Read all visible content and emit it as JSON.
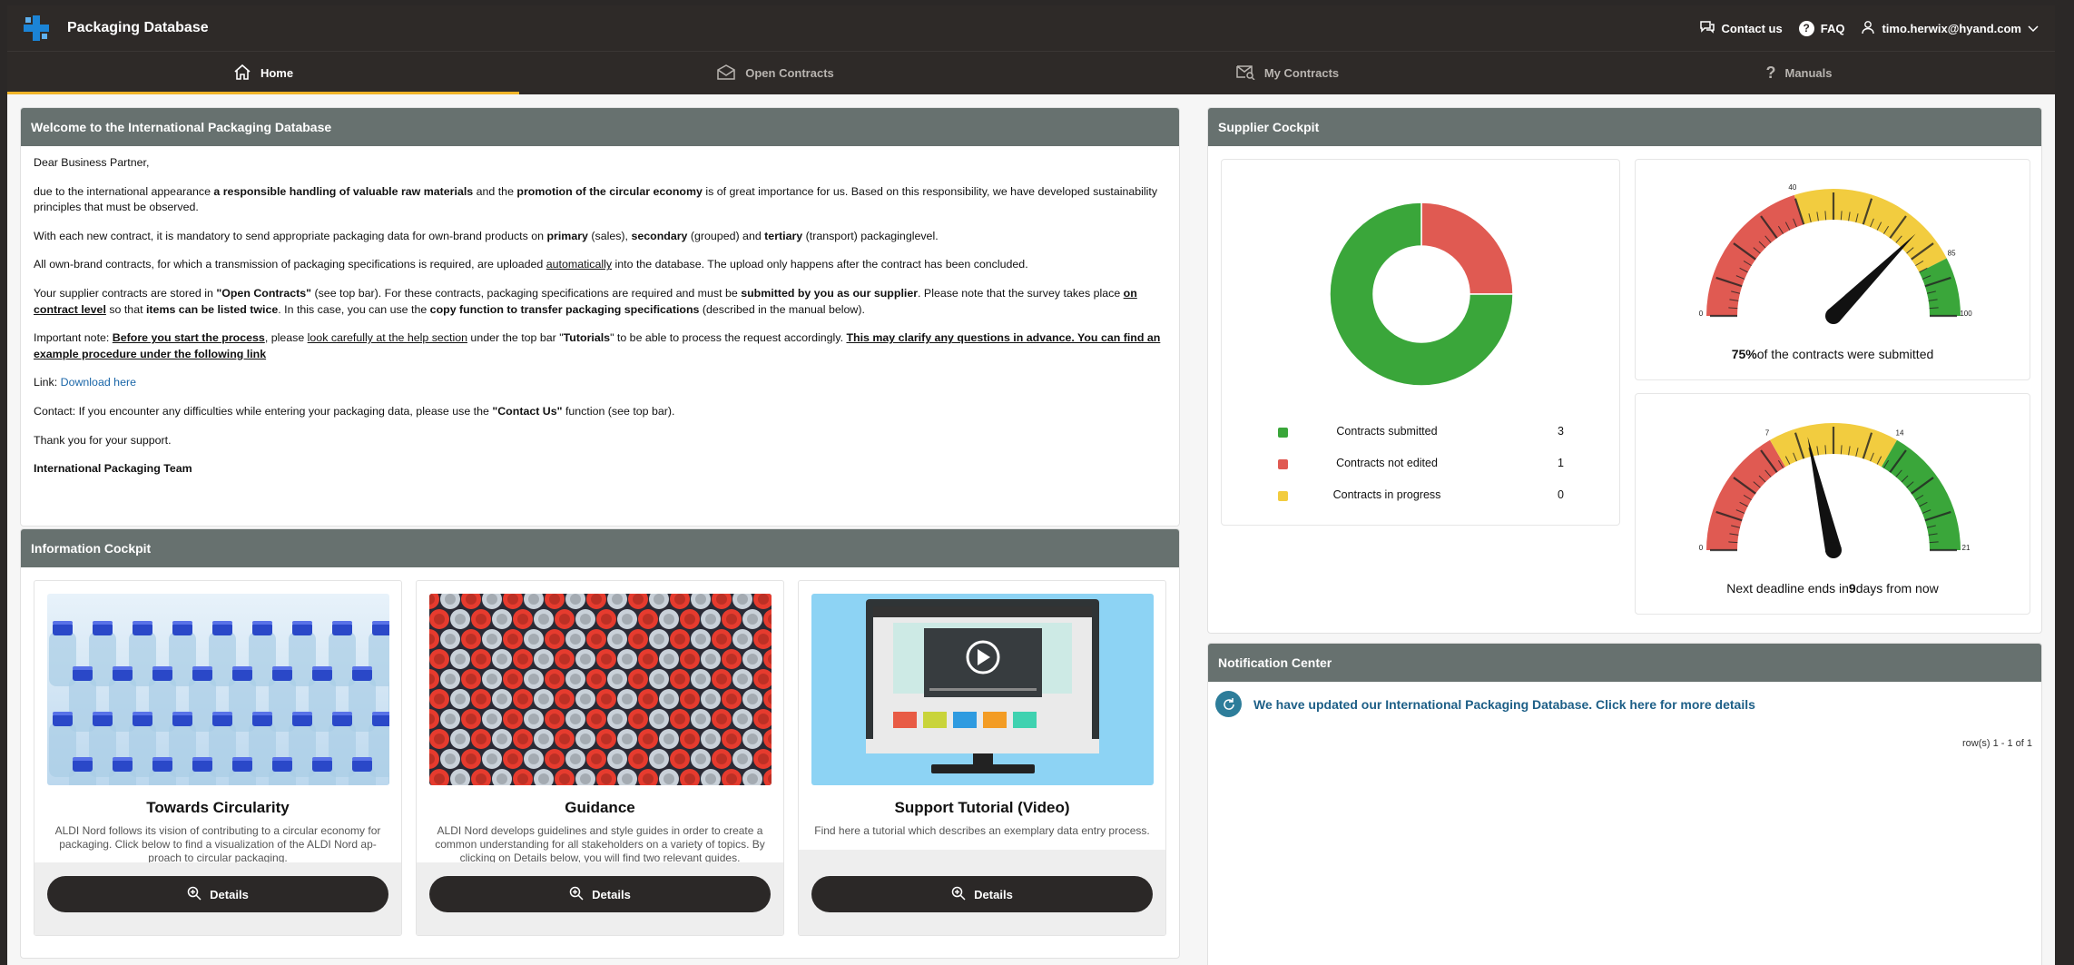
{
  "app": {
    "title": "Packaging Database"
  },
  "topbar": {
    "contact_label": "Contact us",
    "faq_label": "FAQ",
    "user_email": "timo.herwix@hyand.com"
  },
  "nav": {
    "tabs": [
      {
        "label": "Home",
        "active": true
      },
      {
        "label": "Open Contracts"
      },
      {
        "label": "My Contracts"
      },
      {
        "label": "Manuals"
      }
    ]
  },
  "welcome": {
    "title": "Welcome to the International Packaging Database",
    "greeting": "Dear Business Partner,",
    "p1_a": "due to the international appearance ",
    "p1_b": "a responsible handling of valuable raw materials",
    "p1_c": " and the ",
    "p1_d": "promotion of the circular economy",
    "p1_e": " is of great importance for us. Based on this responsibility, we have developed sustainability principles that must be observed.",
    "p2_a": "With each new contract, it is mandatory to send appropriate packaging data for own-brand products on ",
    "p2_b": "primary",
    "p2_c": " (sales), ",
    "p2_d": "secondary",
    "p2_e": " (grouped) and ",
    "p2_f": "tertiary",
    "p2_g": " (transport) packaginglevel.",
    "p3_a": "All own-brand contracts, for which a transmission of packaging specifications is required, are uploaded ",
    "p3_b": "automatically",
    "p3_c": " into the database. The upload only happens after the contract has been concluded.",
    "p4_a": "Your supplier contracts are stored in ",
    "p4_b": "\"Open Contracts\"",
    "p4_c": " (see top bar). For these contracts, packaging specifications are required and must be ",
    "p4_d": "submitted by you as our supplier",
    "p4_e": ". Please note that the survey takes place ",
    "p4_f": "on contract level",
    "p4_g": " so that ",
    "p4_h": "items can be listed twice",
    "p4_i": ". In this case, you can use the ",
    "p4_j": "copy function to transfer packaging specifications",
    "p4_k": " (described in the manual below).",
    "p5_a": "Important note: ",
    "p5_b": "Before you start the process",
    "p5_c": ", please ",
    "p5_d": "look carefully at the help section",
    "p5_e": " under the top bar \"",
    "p5_f": "Tutorials",
    "p5_g": "\" to be able to process the request accordingly. ",
    "p5_h": "This may clarify any questions in advance. You can find an example procedure under the following link",
    "link_prefix": "Link: ",
    "link_label": "Download here",
    "p6_a": "Contact: If you encounter any difficulties while entering your packaging data, please use the ",
    "p6_b": "\"Contact Us\"",
    "p6_c": " function (see top bar).",
    "thanks": "Thank you for your support.",
    "signature": "International Packaging Team"
  },
  "info_cockpit": {
    "title": "Information Cockpit",
    "cards": [
      {
        "title": "Towards Circularity",
        "text": "ALDI Nord follows its vision of contributing to a circular economy for packaging. Click below to find a visualization of the ALDI Nord ap-proach to circular packaging.",
        "button": "Details"
      },
      {
        "title": "Guidance",
        "text": "ALDI Nord develops guidelines and style guides in order to create a common understanding for all stakeholders on a variety of topics. By clicking on Details below, you will find two relevant guides.",
        "button": "Details"
      },
      {
        "title": "Support Tutorial (Video)",
        "text": "Find here a tutorial which describes an exemplary data entry process.",
        "button": "Details"
      }
    ]
  },
  "supplier": {
    "title": "Supplier Cockpit",
    "legend": [
      {
        "label": "Contracts submitted",
        "value": "3",
        "color": "#3aa63a"
      },
      {
        "label": "Contracts not edited",
        "value": "1",
        "color": "#e05a52"
      },
      {
        "label": "Contracts in progress",
        "value": "0",
        "color": "#f2cc3f"
      }
    ],
    "gauge1": {
      "value_pct": 75,
      "ticks": [
        "0",
        "40",
        "85",
        "100"
      ],
      "caption_value": "75%",
      "caption_text": "of the contracts were submitted"
    },
    "gauge2": {
      "value": 9,
      "max": 21,
      "ticks": [
        "0",
        "7",
        "14",
        "21"
      ],
      "caption_pre": "Next deadline ends in",
      "caption_value": "9",
      "caption_post": "days from now"
    }
  },
  "chart_data": [
    {
      "type": "pie",
      "categories": [
        "Contracts submitted",
        "Contracts not edited",
        "Contracts in progress"
      ],
      "values": [
        3,
        1,
        0
      ]
    }
  ],
  "notifications": {
    "title": "Notification Center",
    "items": [
      {
        "text": "We have updated our International Packaging Database. Click here for more details"
      }
    ],
    "rows_info": "row(s) 1 - 1 of 1"
  },
  "colors": {
    "green": "#3aa63a",
    "red": "#e05a52",
    "yellow": "#f2cc3f",
    "accent": "#f0b428",
    "dark": "#2b2827",
    "panel_header": "#67716f"
  }
}
